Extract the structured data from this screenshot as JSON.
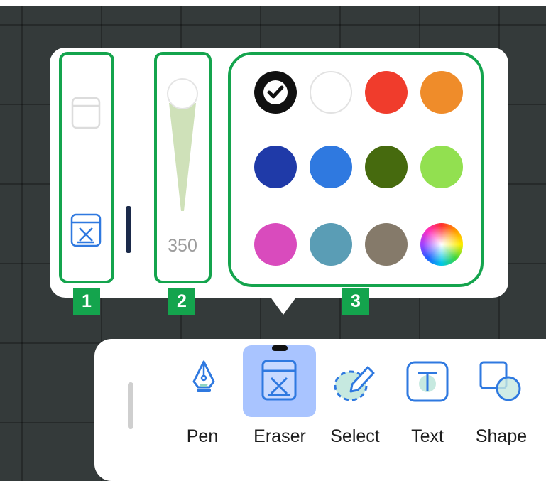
{
  "eraser_panel": {
    "modes": [
      {
        "name": "page-eraser",
        "icon": "page-icon",
        "selected": false
      },
      {
        "name": "clear-eraser",
        "icon": "eraser-box-icon",
        "selected": true
      }
    ],
    "size_slider": {
      "value": "350",
      "level": 0.0
    },
    "colors": [
      {
        "color": "#111111",
        "selected": true
      },
      {
        "color": "#ffffff",
        "selected": false
      },
      {
        "color": "#f03c2c",
        "selected": false
      },
      {
        "color": "#ef8c2a",
        "selected": false
      },
      {
        "color": "#1f3aa8",
        "selected": false
      },
      {
        "color": "#2f79e0",
        "selected": false
      },
      {
        "color": "#466a0e",
        "selected": false
      },
      {
        "color": "#92e050",
        "selected": false
      },
      {
        "color": "#d94bbd",
        "selected": false
      },
      {
        "color": "#5a9db5",
        "selected": false
      },
      {
        "color": "#857a6a",
        "selected": false
      },
      {
        "color": "color-wheel",
        "selected": false
      }
    ]
  },
  "annotations": {
    "badge_1": "1",
    "badge_2": "2",
    "badge_3": "3",
    "highlight_color": "#14a44d"
  },
  "toolbar": {
    "active_tool": "Eraser",
    "tools": [
      {
        "label": "Pen",
        "icon": "pen-nib-icon"
      },
      {
        "label": "Eraser",
        "icon": "eraser-icon"
      },
      {
        "label": "Select",
        "icon": "lasso-select-icon"
      },
      {
        "label": "Text",
        "icon": "text-box-icon"
      },
      {
        "label": "Shape",
        "icon": "shape-icon"
      }
    ]
  },
  "colors": {
    "canvas_bg": "#343a3a",
    "accent_blue": "#2f79e0",
    "active_tool_bg": "#a9c4ff"
  }
}
